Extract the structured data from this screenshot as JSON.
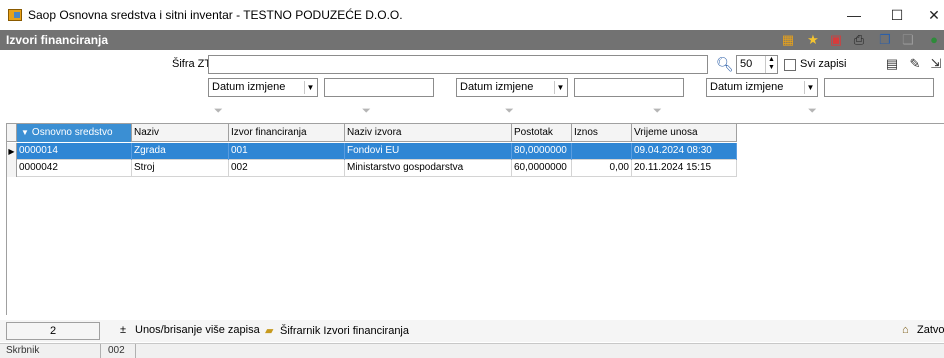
{
  "window": {
    "title": "Saop Osnovna sredstva i sitni inventar - TESTNO PODUZEĆE D.O.O.",
    "minimize": "—",
    "maximize": "☐",
    "close": "✕"
  },
  "module": {
    "title": "Izvori financiranja"
  },
  "filters": {
    "sifra_label": "Šifra ZT",
    "sifra_value": "",
    "limit_value": "50",
    "svi_zapisi_label": "Svi zapisi",
    "svi_zapisi_checked": false,
    "date_filters": [
      {
        "combo": "Datum izmjene",
        "value": ""
      },
      {
        "combo": "Datum izmjene",
        "value": ""
      },
      {
        "combo": "Datum izmjene",
        "value": ""
      }
    ]
  },
  "grid": {
    "columns": [
      "Osnovno sredstvo",
      "Naziv",
      "Izvor financiranja",
      "Naziv izvora",
      "Postotak",
      "Iznos",
      "Vrijeme unosa"
    ],
    "sorted_column": "Osnovno sredstvo",
    "rows": [
      {
        "selected": true,
        "cells": [
          "0000014",
          "Zgrada",
          "001",
          "Fondovi EU",
          "80,0000000",
          "",
          "09.04.2024 08:30"
        ]
      },
      {
        "selected": false,
        "cells": [
          "0000042",
          "Stroj",
          "002",
          "Ministarstvo gospodarstva",
          "60,0000000",
          "0,00",
          "20.11.2024 15:15"
        ]
      }
    ]
  },
  "bottom": {
    "record_count": "2",
    "multi_label": "Unos/brisanje više zapisa",
    "sifrarnik_label": "Šifrarnik Izvori financiranja",
    "close_label": "Zatvo"
  },
  "status": {
    "user_label": "Skrbnik",
    "code": "002"
  },
  "icons": {
    "accent": "#2f86d4",
    "header_bar": "#727272"
  }
}
